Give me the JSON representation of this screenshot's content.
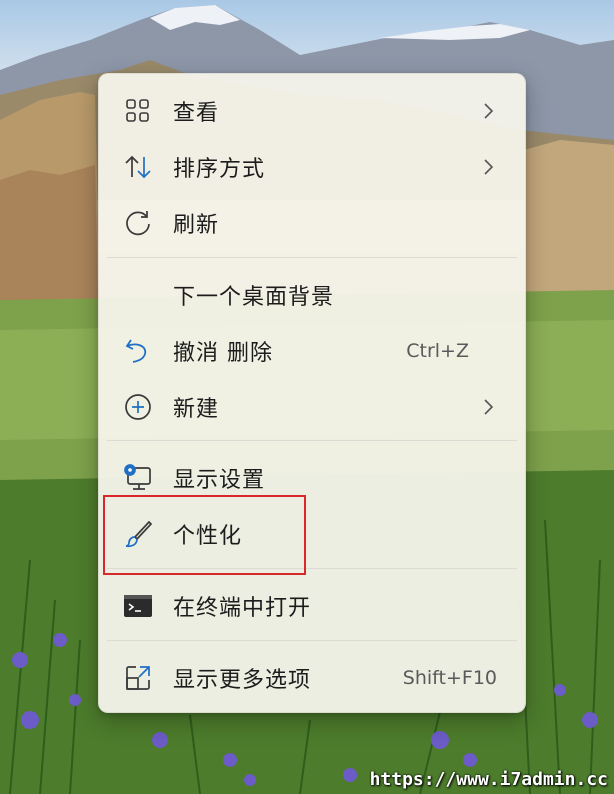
{
  "menu": {
    "items": [
      {
        "label": "查看",
        "icon": "grid-icon",
        "submenu": true
      },
      {
        "label": "排序方式",
        "icon": "sort-arrows-icon",
        "submenu": true
      },
      {
        "label": "刷新",
        "icon": "refresh-icon",
        "submenu": false
      },
      {
        "label": "下一个桌面背景",
        "icon": "",
        "submenu": false
      },
      {
        "label": "撤消 删除",
        "icon": "undo-icon",
        "shortcut": "Ctrl+Z"
      },
      {
        "label": "新建",
        "icon": "plus-circle-icon",
        "submenu": true
      },
      {
        "label": "显示设置",
        "icon": "display-settings-icon",
        "submenu": false
      },
      {
        "label": "个性化",
        "icon": "brush-icon",
        "submenu": false
      },
      {
        "label": "在终端中打开",
        "icon": "terminal-icon",
        "submenu": false
      },
      {
        "label": "显示更多选项",
        "icon": "share-external-icon",
        "shortcut": "Shift+F10"
      }
    ]
  },
  "highlight_color": "#d9282a",
  "accent_color": "#1f6fc5",
  "watermark": "https://www.i7admin.cc"
}
